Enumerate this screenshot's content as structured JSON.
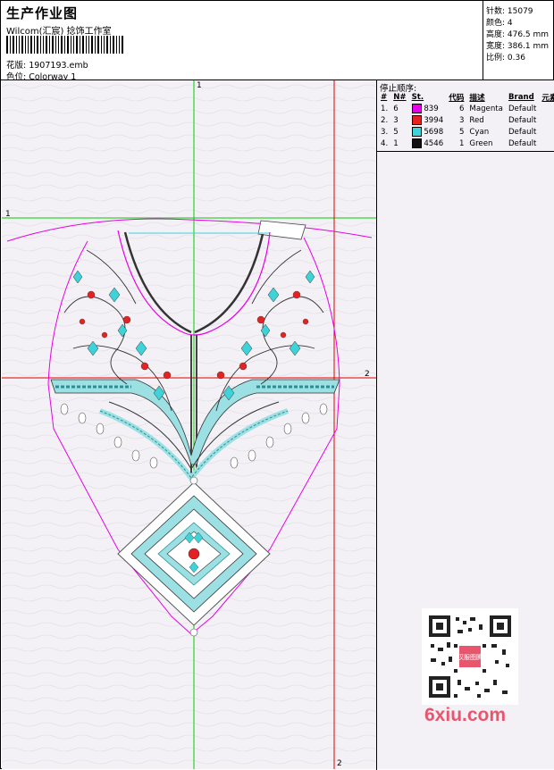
{
  "header": {
    "title": "生产作业图",
    "studio": "Wilcom(汇宸) 捻饰工作室",
    "design_label": "花版: 1907193.emb",
    "colorway_label": "色位:  Colorway 1"
  },
  "stats": {
    "stitches": "针数: 15079",
    "colors": "颜色: 4",
    "height": "高度: 476.5 mm",
    "width": "宽度: 386.1 mm",
    "scale": "比例: 0.36"
  },
  "stop_sequence": {
    "title": "停止顺序:",
    "headers": [
      "#",
      "N#",
      "St.",
      "代码",
      "描述",
      "Brand",
      "元素"
    ],
    "rows": [
      {
        "idx": "1.",
        "n": "6",
        "color": "#e800e8",
        "st": "839",
        "code": "6",
        "desc": "Magenta",
        "brand": "Default"
      },
      {
        "idx": "2.",
        "n": "3",
        "color": "#e52222",
        "st": "3994",
        "code": "3",
        "desc": "Red",
        "brand": "Default"
      },
      {
        "idx": "3.",
        "n": "5",
        "color": "#3ed2d9",
        "st": "5698",
        "code": "5",
        "desc": "Cyan",
        "brand": "Default"
      },
      {
        "idx": "4.",
        "n": "1",
        "color": "#111111",
        "st": "4546",
        "code": "1",
        "desc": "Green",
        "brand": "Default"
      }
    ]
  },
  "guides": {
    "v1": "1",
    "h1": "1",
    "h2": "2",
    "v2": "2"
  },
  "watermark": {
    "text": "6xiu.com",
    "stamp": "汉服图腾"
  },
  "colors": {
    "magenta": "#e800e8",
    "red": "#e52222",
    "cyan": "#3ed2d9",
    "guide_green": "#00cc00",
    "guide_red": "#dd0000"
  }
}
